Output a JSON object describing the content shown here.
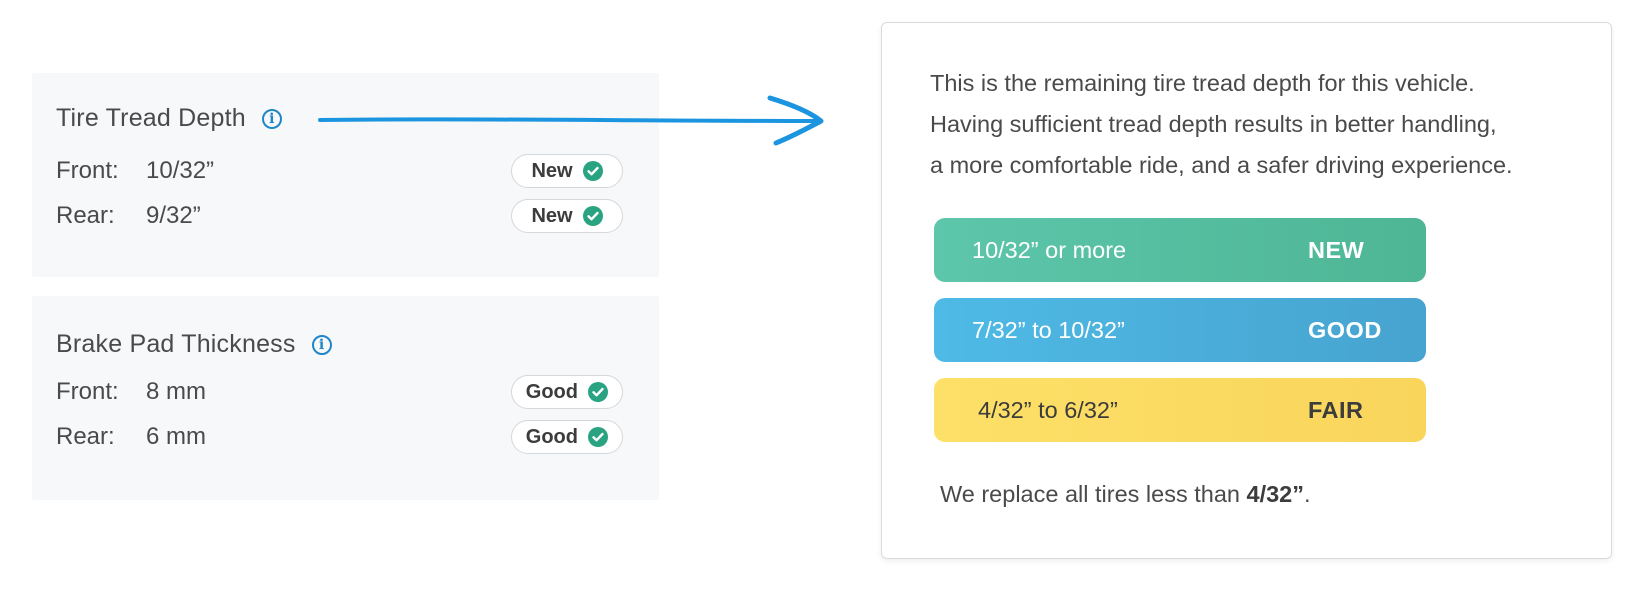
{
  "tire": {
    "title": "Tire Tread Depth",
    "rows": [
      {
        "label": "Front:",
        "value": "10/32”",
        "status": "New"
      },
      {
        "label": "Rear:",
        "value": "9/32”",
        "status": "New"
      }
    ]
  },
  "brake": {
    "title": "Brake Pad Thickness",
    "rows": [
      {
        "label": "Front:",
        "value": "8 mm",
        "status": "Good"
      },
      {
        "label": "Rear:",
        "value": "6 mm",
        "status": "Good"
      }
    ]
  },
  "info_icon": "info-icon",
  "popup": {
    "lines": [
      "This is the remaining tire tread depth for this vehicle.",
      "Having sufficient tread depth results in better handling,",
      "a more comfortable ride, and a safer driving experience."
    ],
    "levels": [
      {
        "range": "10/32” or more",
        "name": "NEW",
        "color": "#52bd9e"
      },
      {
        "range": "7/32” to 10/32”",
        "name": "GOOD",
        "color": "#4aaedb"
      },
      {
        "range": "4/32” to 6/32”",
        "name": "FAIR",
        "color": "#fbda62"
      }
    ],
    "footnote_prefix": "We replace all tires less than ",
    "footnote_value": "4/32”",
    "footnote_suffix": "."
  },
  "colors": {
    "accent": "#1f86c8",
    "check": "#2aa383",
    "card_bg": "#f7f8fa"
  }
}
